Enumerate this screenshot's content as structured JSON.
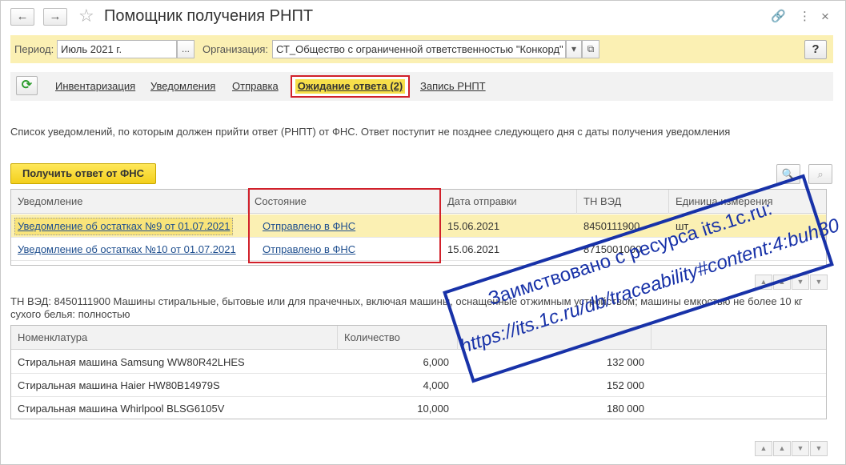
{
  "window": {
    "title": "Помощник получения РНПТ",
    "back_icon": "←",
    "forward_icon": "→",
    "star_icon": "☆",
    "link_icon": "🔗",
    "more_icon": "⋮",
    "close_icon": "×"
  },
  "filters": {
    "period_label": "Период:",
    "period_value": "Июль 2021 г.",
    "period_button": "...",
    "org_label": "Организация:",
    "org_value": "СТ_Общество с ограниченной ответственностью \"Конкорд\"",
    "org_dropdown": "▾",
    "org_open": "⧉",
    "help": "?"
  },
  "tabs": {
    "refresh_icon": "⟳",
    "items": [
      "Инвентаризация",
      "Уведомления",
      "Отправка",
      "Ожидание ответа (2)",
      "Запись РНПТ"
    ]
  },
  "description": "Список уведомлений, по которым должен прийти ответ (РНПТ) от ФНС. Ответ поступит не позднее следующего дня с даты получения уведомления",
  "actions": {
    "get_response": "Получить ответ от ФНС",
    "search_icon": "🔍",
    "search_clear_icon": "⌕"
  },
  "notifications": {
    "columns": [
      "Уведомление",
      "Состояние",
      "Дата отправки",
      "ТН ВЭД",
      "Единица измерения"
    ],
    "rows": [
      {
        "notice": "Уведомление об остатках №9 от 01.07.2021",
        "state": "Отправлено в ФНС",
        "date": "15.06.2021",
        "tnved": "8450111900",
        "unit": "шт"
      },
      {
        "notice": "Уведомление об остатках №10 от 01.07.2021",
        "state": "Отправлено в ФНС",
        "date": "15.06.2021",
        "tnved": "8715001000",
        "unit": ""
      }
    ]
  },
  "scroll": {
    "first": "▲",
    "up": "▲",
    "down": "▼",
    "last": "▼"
  },
  "tnved_text": "ТН ВЭД: 8450111900 Машины стиральные, бытовые или для прачечных, включая машины, оснащенные отжимным устройством; машины емкостью не более 10 кг сухого белья: полностью",
  "goods": {
    "columns": [
      "Номенклатура",
      "Количество",
      "",
      ""
    ],
    "rows": [
      {
        "name": "Стиральная машина Samsung WW80R42LHES",
        "qty": "6,000",
        "sum": "132 000"
      },
      {
        "name": "Стиральная машина Haier HW80B14979S",
        "qty": "4,000",
        "sum": "152 000"
      },
      {
        "name": "Стиральная машина Whirlpool BLSG6105V",
        "qty": "10,000",
        "sum": "180 000"
      }
    ]
  },
  "watermark": {
    "line1": "Заимствовано с ресурса its.1c.ru:",
    "line2": "https://its.1c.ru/db/traceability#content:4:buh30"
  }
}
